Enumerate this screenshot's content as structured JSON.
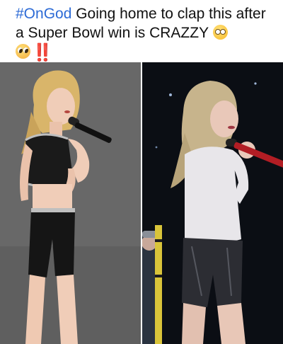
{
  "post": {
    "caption": {
      "hashtag": "#OnGod",
      "text": " Going home to clap this after a Super Bowl win is CRAZZY",
      "emojis": [
        "flushed-face",
        "pleading-face",
        "double-exclamation"
      ],
      "bangbang": "‼️"
    },
    "images": [
      {
        "name": "performer-black-outfit"
      },
      {
        "name": "performer-white-top-leather-shorts"
      }
    ]
  }
}
